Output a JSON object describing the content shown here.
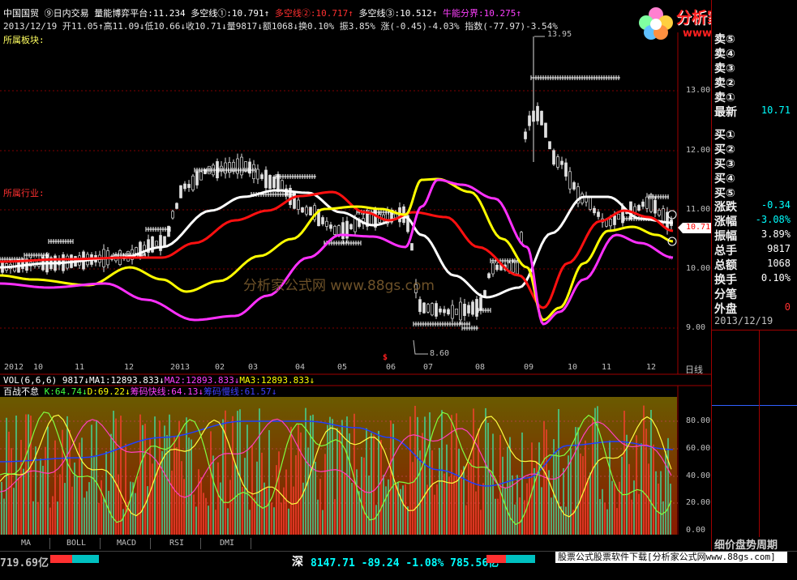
{
  "header": {
    "line1": [
      {
        "text": "中国国贸",
        "color": "#ffffff"
      },
      {
        "text": " ⑨日内交易 ",
        "color": "#ffffff"
      },
      {
        "text": "量能博弈平台:11.234",
        "color": "#ffffff"
      },
      {
        "text": " 多空线①:10.791↑",
        "color": "#ffffff"
      },
      {
        "text": " 多空线②:10.717↑",
        "color": "#ff3030"
      },
      {
        "text": " 多空线③:10.512↑",
        "color": "#ffffff"
      },
      {
        "text": " 牛能分界:10.275↑",
        "color": "#ff40ff"
      }
    ],
    "line2": "2013/12/19 开11.05↑高11.09↓低10.66↓收10.71↓量9817↓额1068↓换0.10% 振3.85% 涨(-0.45)-4.03% 指数(-77.97)-3.54%",
    "line3": "所属板块:",
    "industry": "所属行业:"
  },
  "logo": {
    "title": "分析家公式网",
    "url": "www.88gs.com"
  },
  "watermark": "分析家公式网  www.88gs.com",
  "price_labels": {
    "high": "13.95",
    "low": "8.60",
    "current": "10.71"
  },
  "y_axis": [
    "13.00",
    "12.00",
    "11.00",
    "10.00",
    "9.00"
  ],
  "x_axis": [
    "2012",
    "10",
    "11",
    "12",
    "2013",
    "02",
    "03",
    "04",
    "05",
    "06",
    "07",
    "08",
    "09",
    "10",
    "11",
    "12"
  ],
  "period": "日线",
  "vol_line": [
    {
      "text": "VOL(6,6,6) 9817↓",
      "color": "#ffffff"
    },
    {
      "text": "MA1:12893.833↓",
      "color": "#ffffff"
    },
    {
      "text": "MA2:12893.833↓",
      "color": "#ff40ff"
    },
    {
      "text": "MA3:12893.833↓",
      "color": "#ffff00"
    }
  ],
  "ind_line": [
    {
      "text": "百战不怠 ",
      "color": "#ffffff"
    },
    {
      "text": "K:64.74↓",
      "color": "#40ff40"
    },
    {
      "text": "D:69.22↓",
      "color": "#ffff00"
    },
    {
      "text": "筹码快线:64.13↓",
      "color": "#ff40ff"
    },
    {
      "text": "筹码慢线:61.57↓",
      "color": "#4040ff"
    }
  ],
  "ind_y_axis": [
    "80.00",
    "60.00",
    "40.00",
    "20.00",
    "0.00"
  ],
  "tabs": [
    "MA",
    "BOLL",
    "MACD",
    "RSI",
    "DMI"
  ],
  "status": {
    "left": "719.69亿",
    "shen_label": "深",
    "shen_values": "8147.71 -89.24 -1.08% 785.56亿",
    "promo": "股票公式股票软件下载[分析家公式网www.88gs.com]"
  },
  "right_panel": {
    "rows": [
      {
        "label": "卖⑤",
        "value": "",
        "color": "#ffffff"
      },
      {
        "label": "卖④",
        "value": "",
        "color": "#ffffff"
      },
      {
        "label": "卖③",
        "value": "",
        "color": "#ffffff"
      },
      {
        "label": "卖②",
        "value": "",
        "color": "#ffffff"
      },
      {
        "label": "卖①",
        "value": "",
        "color": "#ffffff"
      },
      {
        "label": "最新",
        "value": "10.71",
        "color": "#00ffff"
      },
      {
        "label": "买①",
        "value": "",
        "color": "#ffffff"
      },
      {
        "label": "买②",
        "value": "",
        "color": "#ffffff"
      },
      {
        "label": "买③",
        "value": "",
        "color": "#ffffff"
      },
      {
        "label": "买④",
        "value": "",
        "color": "#ffffff"
      },
      {
        "label": "买⑤",
        "value": "",
        "color": "#ffffff"
      },
      {
        "label": "涨跌",
        "value": "-0.34",
        "color": "#00ffff"
      },
      {
        "label": "涨幅",
        "value": "-3.08%",
        "color": "#00ffff"
      },
      {
        "label": "振幅",
        "value": "3.89%",
        "color": "#ffffff"
      },
      {
        "label": "总手",
        "value": "9817",
        "color": "#ffffff"
      },
      {
        "label": "总额",
        "value": "1068",
        "color": "#ffffff"
      },
      {
        "label": "换手",
        "value": "0.10%",
        "color": "#ffffff"
      },
      {
        "label": "分笔",
        "value": "",
        "color": "#ffffff"
      },
      {
        "label": "外盘",
        "value": "0",
        "color": "#ff3030"
      }
    ],
    "date": "2013/12/19",
    "bottom_label": "细价盘势周期"
  },
  "colors": {
    "ma_white": "#ffffff",
    "ma_red": "#ff1010",
    "ma_yellow": "#ffff00",
    "ma_magenta": "#ff30ff",
    "up": "#ffffff",
    "down": "#ffffff",
    "panel_border": "#a00000"
  }
}
